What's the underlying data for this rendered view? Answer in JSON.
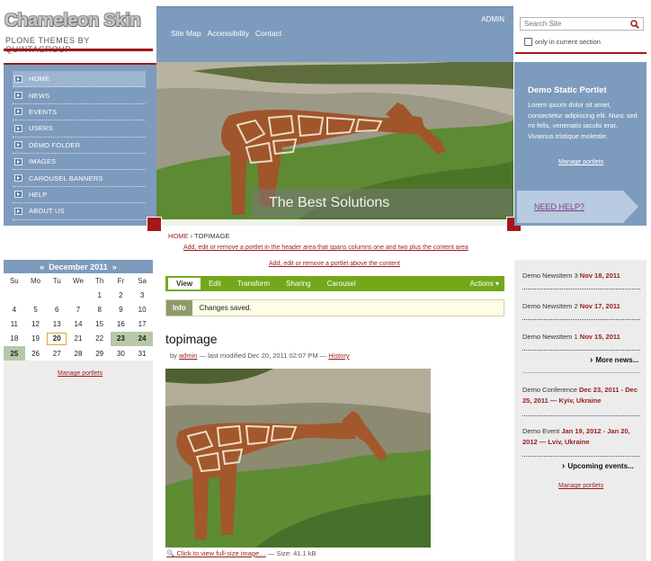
{
  "logo": {
    "title": "Chameleon Skin",
    "subtitle": "PLONE THEMES BY QUINTAGROUP"
  },
  "site_actions": [
    "Site Map",
    "Accessibility",
    "Contact"
  ],
  "user": {
    "name": "ADMIN"
  },
  "search": {
    "placeholder": "Search Site",
    "only_current": "only in current section"
  },
  "nav": {
    "items": [
      "HOME",
      "NEWS",
      "EVENTS",
      "USERS",
      "DEMO FOLDER",
      "IMAGES",
      "CAROUSEL BANNERS",
      "HELP",
      "ABOUT US"
    ],
    "active_index": 0
  },
  "banner": {
    "caption": "The Best Solutions"
  },
  "static_portlet": {
    "title": "Demo Static Portlet",
    "text": "Lorem ipsum dolor sit amet, consectetur adipiscing elit. Nunc sed mi felis, venenatis iaculis erat. Vivamus tristique molestie.",
    "manage": "Manage portlets",
    "help": "NEED HELP?"
  },
  "breadcrumbs": {
    "home": "HOME",
    "current": "TOPIMAGE"
  },
  "notes": {
    "header": "Add, edit or remove a portlet in the header area that spans columns one and two plus the content area",
    "above": "Add, edit or remove a portlet above the content"
  },
  "calendar": {
    "prev": "«",
    "month": "December 2011",
    "next": "»",
    "weekdays": [
      "Su",
      "Mo",
      "Tu",
      "We",
      "Th",
      "Fr",
      "Sa"
    ],
    "weeks": [
      [
        "",
        "",
        "",
        "",
        "1",
        "2",
        "3"
      ],
      [
        "4",
        "5",
        "6",
        "7",
        "8",
        "9",
        "10"
      ],
      [
        "11",
        "12",
        "13",
        "14",
        "15",
        "16",
        "17"
      ],
      [
        "18",
        "19",
        "20",
        "21",
        "22",
        "23",
        "24"
      ],
      [
        "25",
        "26",
        "27",
        "28",
        "29",
        "30",
        "31"
      ]
    ],
    "today": "20",
    "event_days": [
      "23",
      "24",
      "25"
    ],
    "manage": "Manage portlets"
  },
  "tabs": {
    "items": [
      "View",
      "Edit",
      "Transform",
      "Sharing",
      "Carousel"
    ],
    "selected": 0,
    "actions": "Actions"
  },
  "info": {
    "label": "Info",
    "message": "Changes saved."
  },
  "document": {
    "title": "topimage",
    "by": "by",
    "author": "admin",
    "modified": "— last modified Dec 20, 2011 02:07 PM —",
    "history": "History",
    "caption_link": "Click to view full-size image…",
    "size": "— Size: 41.1 kB"
  },
  "news": {
    "items": [
      {
        "title": "Demo NewsItem 3",
        "date": "Nov 18, 2011"
      },
      {
        "title": "Demo NewsItem 2",
        "date": "Nov 17, 2011"
      },
      {
        "title": "Demo NewsItem 1",
        "date": "Nov 15, 2011"
      }
    ],
    "more": "More news..."
  },
  "events": {
    "items": [
      {
        "title": "Demo Conference",
        "date": "Dec 23, 2011 - Dec 25, 2011 — Kyiv, Ukraine"
      },
      {
        "title": "Demo Event",
        "date": "Jan 19, 2012 - Jan 20, 2012 — Lviv, Ukraine"
      }
    ],
    "more": "Upcoming events...",
    "manage": "Manage portlets"
  },
  "colors": {
    "accent_red": "#a4171b",
    "nav_blue": "#7d9bbd",
    "tab_green": "#74a81b"
  }
}
